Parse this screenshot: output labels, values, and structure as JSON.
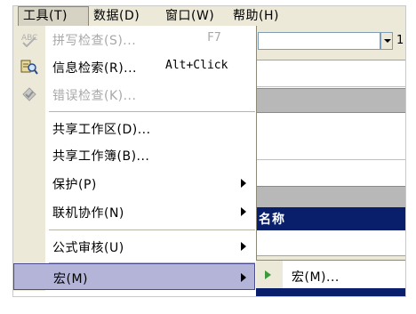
{
  "menubar": {
    "items": [
      {
        "label": "工具(T)",
        "open": true
      },
      {
        "label": "数据(D)"
      },
      {
        "label": "窗口(W)"
      },
      {
        "label": "帮助(H)"
      }
    ]
  },
  "menu": {
    "items": [
      {
        "label": "拼写检查(S)...",
        "shortcut": "F7",
        "disabled": true,
        "icon": "spellcheck-icon"
      },
      {
        "label": "信息检索(R)...",
        "shortcut": "Alt+Click",
        "icon": "research-icon"
      },
      {
        "label": "错误检查(K)...",
        "disabled": true,
        "icon": "error-check-icon"
      },
      {
        "label": "共享工作区(D)..."
      },
      {
        "label": "共享工作簿(B)..."
      },
      {
        "label": "保护(P)",
        "submenu": true
      },
      {
        "label": "联机协作(N)",
        "submenu": true
      },
      {
        "label": "公式审核(U)",
        "submenu": true
      },
      {
        "label": "宏(M)",
        "submenu": true,
        "highlighted": true
      }
    ]
  },
  "submenu": {
    "items": [
      {
        "label": "宏(M)...",
        "icon": "run-macro-icon"
      }
    ]
  },
  "background": {
    "toolbar_number": "1",
    "header_text": "名称"
  },
  "colors": {
    "menu_highlight": "#b4b4d8",
    "menu_highlight_border": "#4b4b8f",
    "header_navy": "#0a1f6b",
    "disabled_text": "#a8a8a8",
    "macro_play_icon": "#3c9a3c"
  }
}
